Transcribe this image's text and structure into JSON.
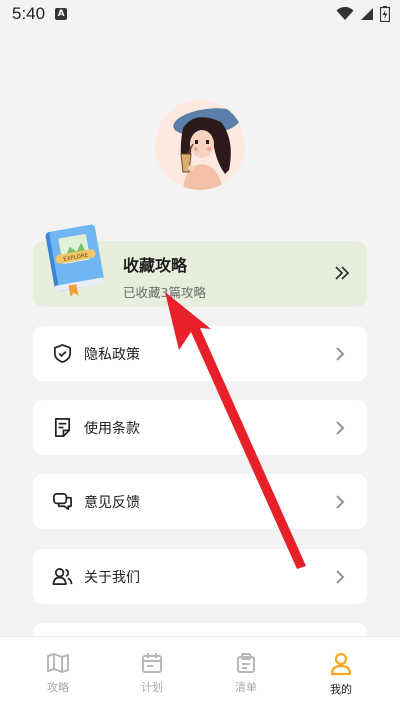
{
  "status_bar": {
    "time": "5:40",
    "notification_badge": "A"
  },
  "favorites_card": {
    "title": "收藏攻略",
    "subtitle": "已收藏3篇攻略",
    "icon": "book-icon",
    "book_badge": "EXPLORE",
    "arrow_icon": "double-chevron-right-icon"
  },
  "menu": [
    {
      "label": "隐私政策",
      "icon": "shield-check-icon"
    },
    {
      "label": "使用条款",
      "icon": "document-icon"
    },
    {
      "label": "意见反馈",
      "icon": "chat-bubbles-icon"
    },
    {
      "label": "关于我们",
      "icon": "users-icon"
    }
  ],
  "tabbar": [
    {
      "label": "攻略",
      "icon": "map-icon",
      "active": false
    },
    {
      "label": "计划",
      "icon": "calendar-icon",
      "active": false
    },
    {
      "label": "清单",
      "icon": "clipboard-icon",
      "active": false
    },
    {
      "label": "我的",
      "icon": "person-icon",
      "active": true
    }
  ],
  "colors": {
    "background": "#f3f3f3",
    "favorites_card_bg": "#e7efdc",
    "active_tab": "#f5a623",
    "inactive_tab": "#b8b8b8",
    "annotation_arrow": "#e8202a"
  }
}
